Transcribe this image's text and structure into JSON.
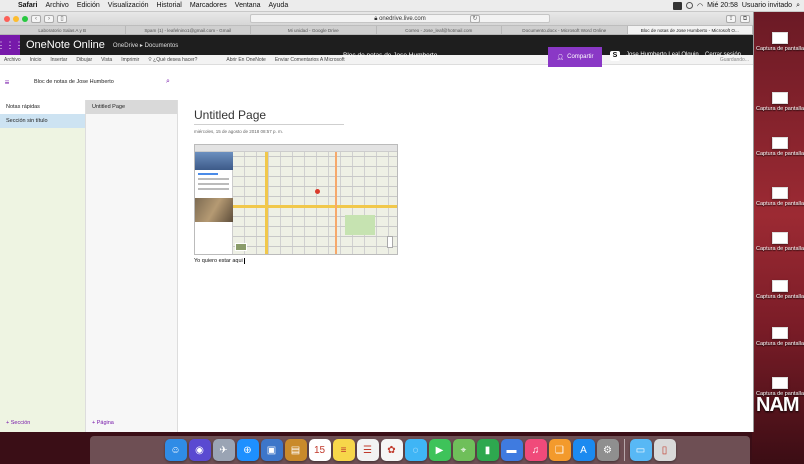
{
  "menubar": {
    "items": [
      "Safari",
      "Archivo",
      "Edición",
      "Visualización",
      "Historial",
      "Marcadores",
      "Ventana",
      "Ayuda"
    ],
    "clock": "Mié 20:58",
    "user": "Usuario invitado"
  },
  "browser": {
    "url": "onedrive.live.com",
    "tabs": [
      "Laboratorio Salas A y B",
      "Spam (1) - leafelnino1@gmail.com - Gmail",
      "Mi unidad - Google Drive",
      "Correo - Jose_leaf@hotmail.com",
      "Documento.docx - Microsoft Word Online",
      "Bloc de notas de Jose Humberto - Microsoft O..."
    ],
    "active_tab": 5
  },
  "onenote": {
    "app_title": "OneNote Online",
    "breadcrumb": "OneDrive  ▸  Documentos",
    "notebook_title": "Bloc de notas de Jose Humberto",
    "share_label": "Compartir",
    "user_name": "Jose Humberto Leal Olguin",
    "signout_label": "Cerrar sesión",
    "ribbon": [
      "Archivo",
      "Inicio",
      "Insertar",
      "Dibujar",
      "Vista",
      "Imprimir"
    ],
    "tell_me": "¿Qué desea hacer?",
    "open_in_onenote": "Abrir En OneNote",
    "send_comments": "Enviar Comentarios A Microsoft",
    "save_status": "Guardando...",
    "notebook_name": "Bloc de notas de Jose Humberto",
    "sections": [
      "Notas rápidas",
      "Sección sin título"
    ],
    "pages": [
      "Untitled Page"
    ],
    "add_section": "+ Sección",
    "add_page": "+ Página",
    "page": {
      "title": "Untitled Page",
      "date": "miércoles, 15 de agosto de 2018     08:57 p. m.",
      "note_text": "Yo quiero estar aqui"
    }
  },
  "desktop": {
    "files": [
      {
        "caption": "Captura de pantalla...20.5"
      },
      {
        "caption": "Captura de pantalla...) 20.1"
      },
      {
        "caption": "Captura de pantalla...20.1!"
      },
      {
        "caption": "Captura de pantalla...20.2"
      },
      {
        "caption": "Captura de pantalla...20.2"
      },
      {
        "caption": "Captura de pantalla...20.2"
      },
      {
        "caption": "Captura de pantalla...20.3"
      },
      {
        "caption": "Captura de pantalla...20.3"
      }
    ],
    "watermark": "NAM"
  },
  "dock": {
    "apps": [
      {
        "icon": "finder-icon",
        "color": "#2f8ce6",
        "glyph": "☺"
      },
      {
        "icon": "siri-icon",
        "color": "#5a4ad1",
        "glyph": "◉"
      },
      {
        "icon": "launchpad-icon",
        "color": "#9aa4b4",
        "glyph": "✈"
      },
      {
        "icon": "safari-icon",
        "color": "#1e90ff",
        "glyph": "⊕"
      },
      {
        "icon": "photos-app-icon",
        "color": "#3d76c9",
        "glyph": "▣"
      },
      {
        "icon": "notes-book-icon",
        "color": "#c98a2b",
        "glyph": "▤"
      },
      {
        "icon": "calendar-icon",
        "color": "#ffffff",
        "glyph": "15"
      },
      {
        "icon": "notes-icon",
        "color": "#f7d64a",
        "glyph": "≡"
      },
      {
        "icon": "reminders-icon",
        "color": "#f2f2f2",
        "glyph": "☰"
      },
      {
        "icon": "photos-icon",
        "color": "#f5f5f5",
        "glyph": "✿"
      },
      {
        "icon": "messages-icon",
        "color": "#3fb5f5",
        "glyph": "◌"
      },
      {
        "icon": "facetime-icon",
        "color": "#3ec35a",
        "glyph": "▶"
      },
      {
        "icon": "maps-icon",
        "color": "#6fbf5a",
        "glyph": "⌖"
      },
      {
        "icon": "numbers-icon",
        "color": "#2ea84f",
        "glyph": "▮"
      },
      {
        "icon": "keynote-icon",
        "color": "#3f7be0",
        "glyph": "▬"
      },
      {
        "icon": "music-icon",
        "color": "#f04a7a",
        "glyph": "♫"
      },
      {
        "icon": "books-icon",
        "color": "#f39a2c",
        "glyph": "❑"
      },
      {
        "icon": "app-store-icon",
        "color": "#1b8af0",
        "glyph": "A"
      },
      {
        "icon": "system-preferences-icon",
        "color": "#8f8f8f",
        "glyph": "⚙"
      },
      {
        "icon": "downloads-folder-icon",
        "color": "#58b8f5",
        "glyph": "▭"
      },
      {
        "icon": "trash-icon",
        "color": "#d9d9d9",
        "glyph": "▯"
      }
    ]
  }
}
